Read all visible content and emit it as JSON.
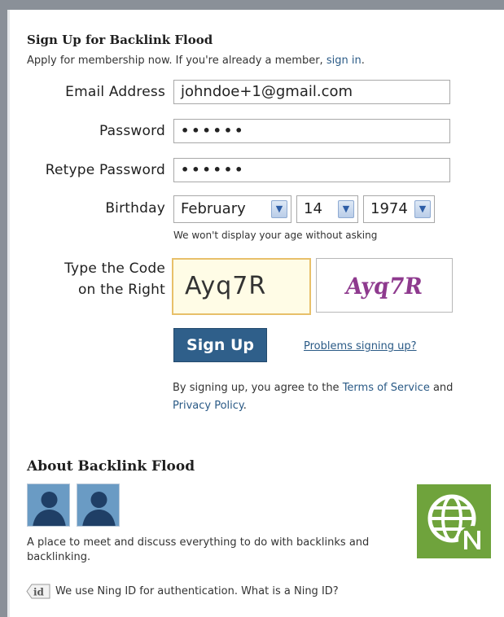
{
  "signup": {
    "heading": "Sign Up for Backlink Flood",
    "intro_text": "Apply for membership now. If you're already a member, ",
    "sign_in_link": "sign in",
    "intro_suffix": "."
  },
  "form": {
    "email_label": "Email Address",
    "email_value": "johndoe+1@gmail.com",
    "password_label": "Password",
    "password_value": "••••••",
    "retype_label": "Retype Password",
    "retype_value": "••••••",
    "birthday_label": "Birthday",
    "birthday_month": "February",
    "birthday_day": "14",
    "birthday_year": "1974",
    "birthday_hint": "We won't display your age without asking",
    "code_label_line1": "Type the Code",
    "code_label_line2": "on the Right",
    "code_value": "Ayq7R",
    "captcha_text": "Ayq7R",
    "signup_button": "Sign Up",
    "problems_link": "Problems signing up?",
    "terms_prefix": "By signing up, you agree to the ",
    "terms_link": "Terms of Service",
    "terms_and": " and",
    "privacy_link": "Privacy Policy",
    "terms_suffix": "."
  },
  "about": {
    "heading": "About Backlink Flood",
    "description": "A place to meet and discuss everything to do with backlinks and backlinking.",
    "ning_id_badge": "id",
    "ning_id_text": "We use Ning ID for authentication. What is a Ning ID?"
  },
  "icons": {
    "avatar": "person-silhouette-icon",
    "logo": "globe-n-logo-icon",
    "select_arrow": "chevron-down-icon",
    "id_badge": "ning-id-tag-icon"
  },
  "colors": {
    "link": "#2a5a86",
    "button": "#2f5f8a",
    "captcha": "#8e3a8e",
    "logo_bg": "#6fa33c"
  }
}
